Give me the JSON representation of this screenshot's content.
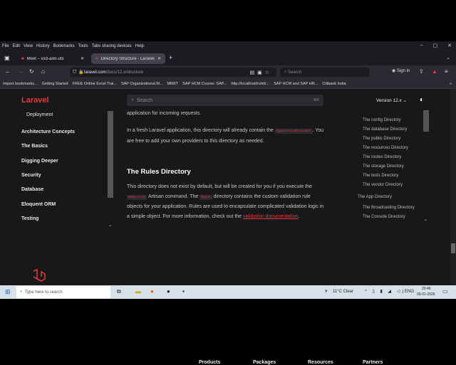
{
  "menubar": [
    "File",
    "Edit",
    "View",
    "History",
    "Bookmarks",
    "Tools",
    "Tabs sharing devices",
    "Help"
  ],
  "tabs": [
    {
      "label": "Meet – xxd-axki-utx"
    },
    {
      "label": "Directory Structure - Laravel 12.x"
    }
  ],
  "url": {
    "domain": "laravel.com",
    "path": "/docs/12.x/structure"
  },
  "browser_search_placeholder": "Search",
  "sign_in": "Sign in",
  "bookmarks": [
    "Import bookmarks...",
    "Getting Started",
    "FREE Online Excel Trai...",
    "SAP Organizational M...",
    "MMIIT",
    "SAP HCM Course: SAP...",
    "http://localhost/rohit/...",
    "SAP HCM and SAP HR...",
    "Citibank India"
  ],
  "site": {
    "logo": "Laravel",
    "search_placeholder": "Search",
    "search_shortcut": "⌘K",
    "version": "Version 12.x",
    "accent": "#e23b3b"
  },
  "sidebar": {
    "sub": "Deployment",
    "items": [
      "Architecture Concepts",
      "The Basics",
      "Digging Deeper",
      "Security",
      "Database",
      "Eloquent ORM",
      "Testing"
    ]
  },
  "content": {
    "p0": "application for incoming requests.",
    "p1a": "In a fresh Laravel application, this directory will already contain the ",
    "p1code": "AppServiceProvider",
    "p1b": ". You are free to add your own providers to this directory as needed.",
    "heading": "The Rules Directory",
    "p2a": "This directory does not exist by default, but will be created for you if you execute the ",
    "p2code1": "make:rule",
    "p2b": " Artisan command. The ",
    "p2code2": "Rules",
    "p2c": " directory contains the custom validation rule objects for your application. Rules are used to encapsulate complicated validation logic in a simple object. For more information, check out the ",
    "p2link": "validation documentation",
    "p2d": "."
  },
  "toc": [
    "The config Directory",
    "The database Directory",
    "The public Directory",
    "The resources Directory",
    "The routes Directory",
    "The storage Directory",
    "The tests Directory",
    "The vendor Directory",
    "The App Directory",
    "The Broadcasting Directory",
    "The Console Directory"
  ],
  "footer": [
    "Products",
    "Packages",
    "Resources",
    "Partners"
  ],
  "taskbar": {
    "search_placeholder": "Type here to search",
    "weather": "11°C  Clear",
    "lang": "ENG",
    "time": "20:46",
    "date": "09-01-2026"
  }
}
